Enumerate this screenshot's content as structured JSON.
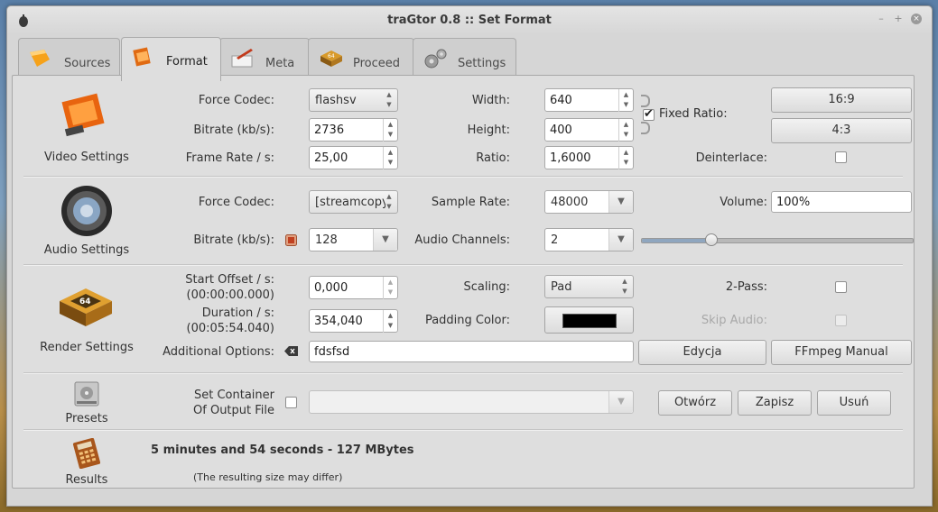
{
  "window": {
    "title": "traGtor 0.8 :: Set Format",
    "controls": {
      "minimize": "–",
      "maximize": "+",
      "close": "×"
    }
  },
  "tabs": [
    {
      "label": "Sources",
      "icon": "sources-icon",
      "active": false
    },
    {
      "label": "Format",
      "icon": "format-icon",
      "active": true
    },
    {
      "label": "Meta",
      "icon": "meta-icon",
      "active": false
    },
    {
      "label": "Proceed",
      "icon": "proceed-icon",
      "active": false
    },
    {
      "label": "Settings",
      "icon": "settings-icon",
      "active": false
    }
  ],
  "video": {
    "section_label": "Video Settings",
    "force_codec_label": "Force Codec:",
    "force_codec_value": "flashsv",
    "bitrate_label": "Bitrate (kb/s):",
    "bitrate_value": "2736",
    "frame_rate_label": "Frame Rate / s:",
    "frame_rate_value": "25,00",
    "width_label": "Width:",
    "width_value": "640",
    "height_label": "Height:",
    "height_value": "400",
    "ratio_label": "Ratio:",
    "ratio_value": "1,6000",
    "fixed_ratio_label": "Fixed Ratio:",
    "fixed_ratio_checked": true,
    "btn_16_9": "16:9",
    "btn_4_3": "4:3",
    "deinterlace_label": "Deinterlace:",
    "deinterlace_checked": false
  },
  "audio": {
    "section_label": "Audio Settings",
    "force_codec_label": "Force Codec:",
    "force_codec_value": "[streamcopy]",
    "bitrate_label": "Bitrate (kb/s):",
    "bitrate_value": "128",
    "sample_rate_label": "Sample Rate:",
    "sample_rate_value": "48000",
    "channels_label": "Audio Channels:",
    "channels_value": "2",
    "volume_label": "Volume:",
    "volume_value": "100%",
    "volume_slider_fraction": 0.26
  },
  "render": {
    "section_label": "Render Settings",
    "start_offset_label": "Start Offset / s:",
    "start_offset_sub": "(00:00:00.000)",
    "start_offset_value": "0,000",
    "duration_label": "Duration / s:",
    "duration_sub": "(00:05:54.040)",
    "duration_value": "354,040",
    "scaling_label": "Scaling:",
    "scaling_value": "Pad",
    "padding_color_label": "Padding Color:",
    "padding_color": "#000000",
    "two_pass_label": "2-Pass:",
    "skip_audio_label": "Skip Audio:",
    "additional_options_label": "Additional Options:",
    "additional_options_value": "fdsfsd",
    "edit_button": "Edycja",
    "ffmpeg_manual_button": "FFmpeg Manual"
  },
  "presets": {
    "section_label": "Presets",
    "container_label_line1": "Set Container",
    "container_label_line2": "Of Output File",
    "container_value": "",
    "open_button": "Otwórz",
    "save_button": "Zapisz",
    "delete_button": "Usuń"
  },
  "results": {
    "section_label": "Results",
    "summary": "5 minutes and 54 seconds - 127 MBytes",
    "note": "(The resulting size may differ)"
  }
}
